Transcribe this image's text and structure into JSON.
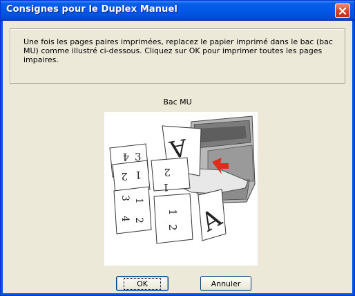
{
  "window": {
    "title": "Consignes pour le Duplex Manuel"
  },
  "message": {
    "text": "Une fois les pages paires imprimées, replacez le papier imprimé dans le bac (bac MU) comme illustré ci-dessous. Cliquez sur OK pour imprimer toutes les pages impaires."
  },
  "illustration": {
    "caption": "Bac MU",
    "page_letter": "A",
    "colors": {
      "printer_gray": "#8a8a8a",
      "arrow_red": "#e02a1a",
      "indicator_blue": "#1e3fb0"
    }
  },
  "buttons": {
    "ok_label": "OK",
    "cancel_label": "Annuler"
  },
  "colors": {
    "title_bar": "#0058e6",
    "dialog_bg": "#ece9d8",
    "close_button": "#d8482d"
  }
}
